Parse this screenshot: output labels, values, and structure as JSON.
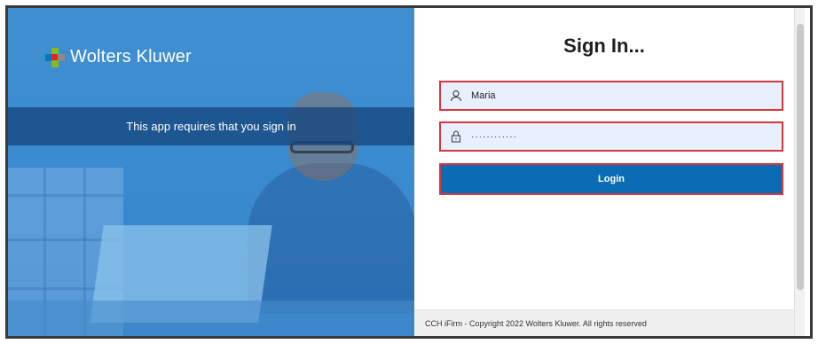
{
  "brand": {
    "name": "Wolters Kluwer",
    "logo_colors": [
      "#85bc20",
      "#e5202e",
      "#007ac3",
      "#8a8a8a"
    ]
  },
  "hero": {
    "message": "This app requires that you sign in"
  },
  "form": {
    "title": "Sign In...",
    "username_value": "Maria",
    "password_value": "············",
    "login_label": "Login"
  },
  "footer": {
    "text": "CCH iFirm - Copyright 2022 Wolters Kluwer. All rights reserved"
  },
  "colors": {
    "accent": "#0b6cb5",
    "highlight_border": "#d9363e",
    "field_bg": "#e8efff",
    "hero_blue": "#3a8ad0"
  },
  "icons": {
    "username": "user-icon",
    "password": "lock-icon"
  }
}
